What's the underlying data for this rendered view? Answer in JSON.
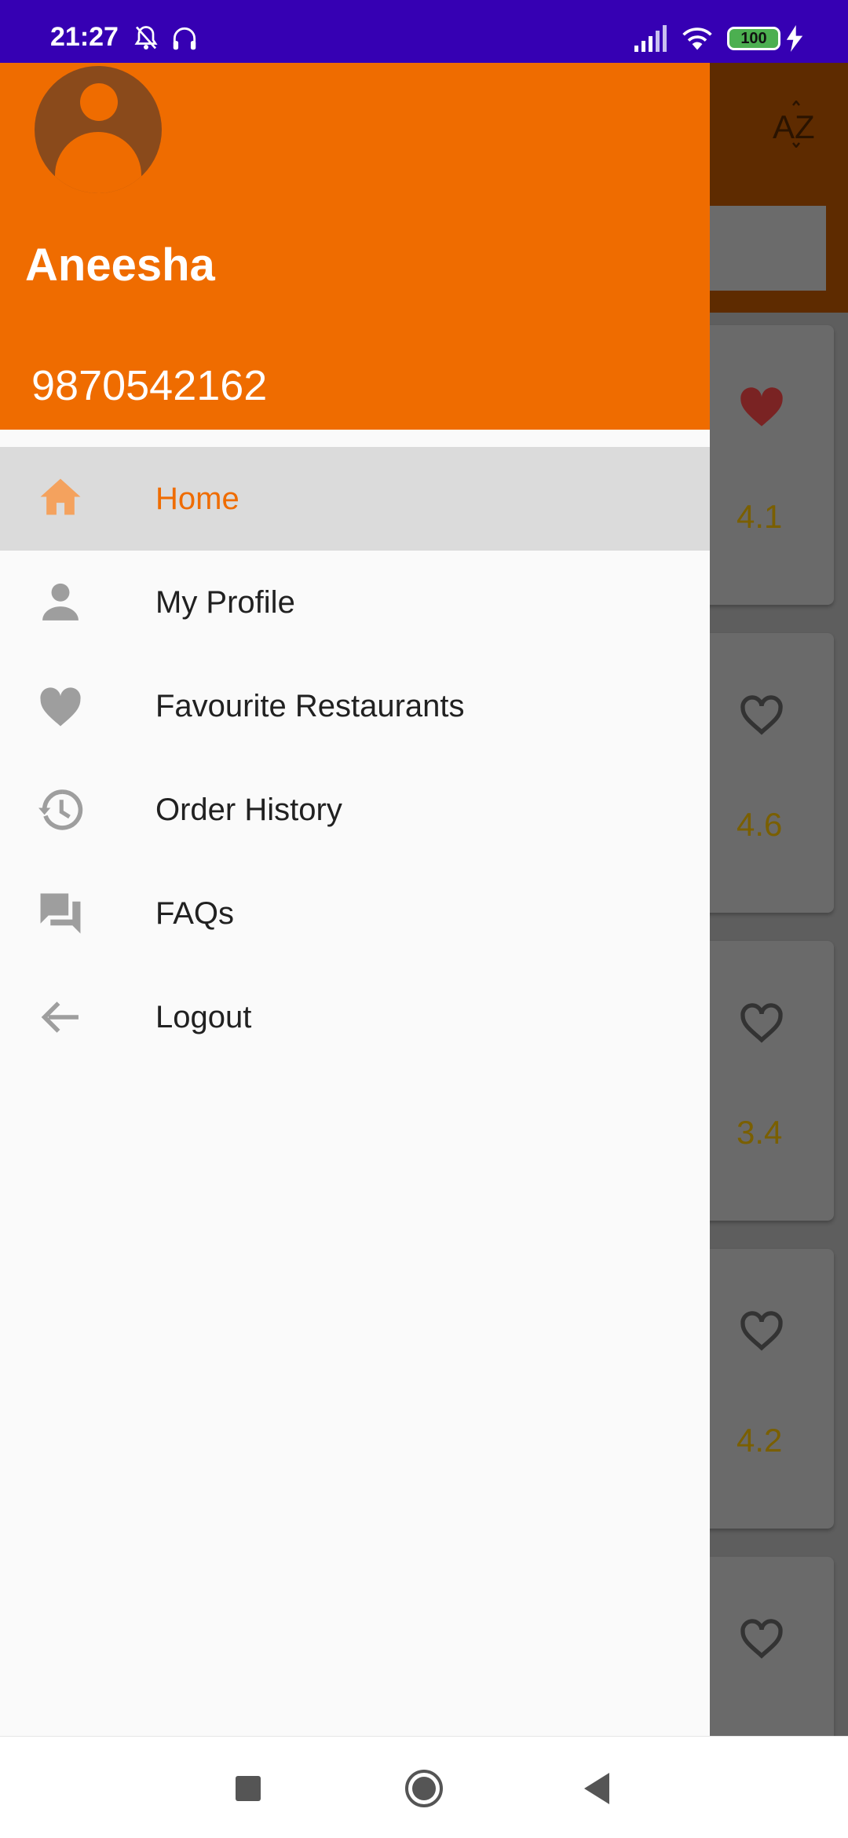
{
  "status_bar": {
    "time": "21:27",
    "battery": "100",
    "icons": [
      "mute-bell-icon",
      "headset-icon",
      "signal-icon",
      "wifi-icon",
      "battery-icon",
      "charging-icon"
    ]
  },
  "background": {
    "sort_icon": "sort-az-icon",
    "restaurants": [
      {
        "rating": "4.1",
        "favourite": true
      },
      {
        "rating": "4.6",
        "favourite": false
      },
      {
        "rating": "3.4",
        "favourite": false
      },
      {
        "rating": "4.2",
        "favourite": false
      },
      {
        "rating": "",
        "favourite": false
      }
    ]
  },
  "drawer": {
    "user_name": "Aneesha",
    "user_phone": "9870542162",
    "items": [
      {
        "label": "Home",
        "icon": "home-icon",
        "active": true
      },
      {
        "label": "My Profile",
        "icon": "person-icon",
        "active": false
      },
      {
        "label": "Favourite Restaurants",
        "icon": "heart-icon",
        "active": false
      },
      {
        "label": "Order History",
        "icon": "history-icon",
        "active": false
      },
      {
        "label": "FAQs",
        "icon": "chat-icon",
        "active": false
      },
      {
        "label": "Logout",
        "icon": "arrow-back-icon",
        "active": false
      }
    ]
  },
  "colors": {
    "accent": "#ef6c00",
    "status_bar": "#3600b3",
    "active_item_bg": "#dbdbdb",
    "icon_grey": "#9e9e9e"
  }
}
